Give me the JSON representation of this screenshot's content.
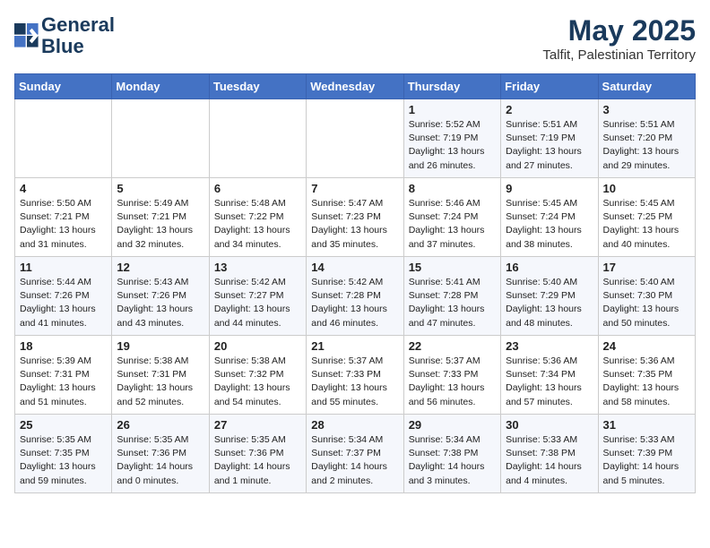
{
  "header": {
    "logo_line1": "General",
    "logo_line2": "Blue",
    "month": "May 2025",
    "location": "Talfit, Palestinian Territory"
  },
  "days_of_week": [
    "Sunday",
    "Monday",
    "Tuesday",
    "Wednesday",
    "Thursday",
    "Friday",
    "Saturday"
  ],
  "weeks": [
    [
      {
        "day": "",
        "info": ""
      },
      {
        "day": "",
        "info": ""
      },
      {
        "day": "",
        "info": ""
      },
      {
        "day": "",
        "info": ""
      },
      {
        "day": "1",
        "info": "Sunrise: 5:52 AM\nSunset: 7:19 PM\nDaylight: 13 hours\nand 26 minutes."
      },
      {
        "day": "2",
        "info": "Sunrise: 5:51 AM\nSunset: 7:19 PM\nDaylight: 13 hours\nand 27 minutes."
      },
      {
        "day": "3",
        "info": "Sunrise: 5:51 AM\nSunset: 7:20 PM\nDaylight: 13 hours\nand 29 minutes."
      }
    ],
    [
      {
        "day": "4",
        "info": "Sunrise: 5:50 AM\nSunset: 7:21 PM\nDaylight: 13 hours\nand 31 minutes."
      },
      {
        "day": "5",
        "info": "Sunrise: 5:49 AM\nSunset: 7:21 PM\nDaylight: 13 hours\nand 32 minutes."
      },
      {
        "day": "6",
        "info": "Sunrise: 5:48 AM\nSunset: 7:22 PM\nDaylight: 13 hours\nand 34 minutes."
      },
      {
        "day": "7",
        "info": "Sunrise: 5:47 AM\nSunset: 7:23 PM\nDaylight: 13 hours\nand 35 minutes."
      },
      {
        "day": "8",
        "info": "Sunrise: 5:46 AM\nSunset: 7:24 PM\nDaylight: 13 hours\nand 37 minutes."
      },
      {
        "day": "9",
        "info": "Sunrise: 5:45 AM\nSunset: 7:24 PM\nDaylight: 13 hours\nand 38 minutes."
      },
      {
        "day": "10",
        "info": "Sunrise: 5:45 AM\nSunset: 7:25 PM\nDaylight: 13 hours\nand 40 minutes."
      }
    ],
    [
      {
        "day": "11",
        "info": "Sunrise: 5:44 AM\nSunset: 7:26 PM\nDaylight: 13 hours\nand 41 minutes."
      },
      {
        "day": "12",
        "info": "Sunrise: 5:43 AM\nSunset: 7:26 PM\nDaylight: 13 hours\nand 43 minutes."
      },
      {
        "day": "13",
        "info": "Sunrise: 5:42 AM\nSunset: 7:27 PM\nDaylight: 13 hours\nand 44 minutes."
      },
      {
        "day": "14",
        "info": "Sunrise: 5:42 AM\nSunset: 7:28 PM\nDaylight: 13 hours\nand 46 minutes."
      },
      {
        "day": "15",
        "info": "Sunrise: 5:41 AM\nSunset: 7:28 PM\nDaylight: 13 hours\nand 47 minutes."
      },
      {
        "day": "16",
        "info": "Sunrise: 5:40 AM\nSunset: 7:29 PM\nDaylight: 13 hours\nand 48 minutes."
      },
      {
        "day": "17",
        "info": "Sunrise: 5:40 AM\nSunset: 7:30 PM\nDaylight: 13 hours\nand 50 minutes."
      }
    ],
    [
      {
        "day": "18",
        "info": "Sunrise: 5:39 AM\nSunset: 7:31 PM\nDaylight: 13 hours\nand 51 minutes."
      },
      {
        "day": "19",
        "info": "Sunrise: 5:38 AM\nSunset: 7:31 PM\nDaylight: 13 hours\nand 52 minutes."
      },
      {
        "day": "20",
        "info": "Sunrise: 5:38 AM\nSunset: 7:32 PM\nDaylight: 13 hours\nand 54 minutes."
      },
      {
        "day": "21",
        "info": "Sunrise: 5:37 AM\nSunset: 7:33 PM\nDaylight: 13 hours\nand 55 minutes."
      },
      {
        "day": "22",
        "info": "Sunrise: 5:37 AM\nSunset: 7:33 PM\nDaylight: 13 hours\nand 56 minutes."
      },
      {
        "day": "23",
        "info": "Sunrise: 5:36 AM\nSunset: 7:34 PM\nDaylight: 13 hours\nand 57 minutes."
      },
      {
        "day": "24",
        "info": "Sunrise: 5:36 AM\nSunset: 7:35 PM\nDaylight: 13 hours\nand 58 minutes."
      }
    ],
    [
      {
        "day": "25",
        "info": "Sunrise: 5:35 AM\nSunset: 7:35 PM\nDaylight: 13 hours\nand 59 minutes."
      },
      {
        "day": "26",
        "info": "Sunrise: 5:35 AM\nSunset: 7:36 PM\nDaylight: 14 hours\nand 0 minutes."
      },
      {
        "day": "27",
        "info": "Sunrise: 5:35 AM\nSunset: 7:36 PM\nDaylight: 14 hours\nand 1 minute."
      },
      {
        "day": "28",
        "info": "Sunrise: 5:34 AM\nSunset: 7:37 PM\nDaylight: 14 hours\nand 2 minutes."
      },
      {
        "day": "29",
        "info": "Sunrise: 5:34 AM\nSunset: 7:38 PM\nDaylight: 14 hours\nand 3 minutes."
      },
      {
        "day": "30",
        "info": "Sunrise: 5:33 AM\nSunset: 7:38 PM\nDaylight: 14 hours\nand 4 minutes."
      },
      {
        "day": "31",
        "info": "Sunrise: 5:33 AM\nSunset: 7:39 PM\nDaylight: 14 hours\nand 5 minutes."
      }
    ]
  ]
}
